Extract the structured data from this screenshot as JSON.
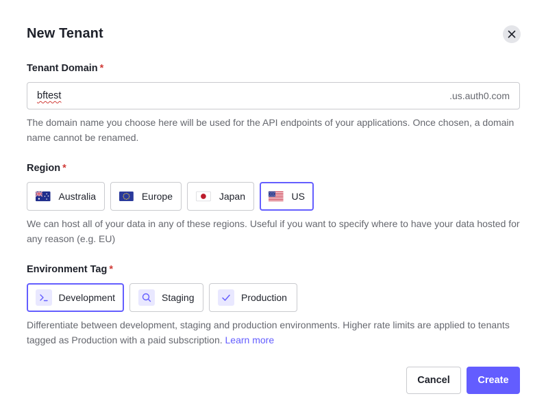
{
  "dialog": {
    "title": "New Tenant"
  },
  "tenant_domain": {
    "label": "Tenant Domain",
    "required_mark": "*",
    "value": "bftest",
    "suffix": ".us.auth0.com",
    "help": "The domain name you choose here will be used for the API endpoints of your applications. Once chosen, a domain name cannot be renamed."
  },
  "region": {
    "label": "Region",
    "required_mark": "*",
    "options": [
      {
        "label": "Australia",
        "icon": "australia-flag-icon"
      },
      {
        "label": "Europe",
        "icon": "eu-flag-icon"
      },
      {
        "label": "Japan",
        "icon": "japan-flag-icon"
      },
      {
        "label": "US",
        "icon": "us-flag-icon",
        "selected": true
      }
    ],
    "help": "We can host all of your data in any of these regions. Useful if you want to specify where to have your data hosted for any reason (e.g. EU)"
  },
  "environment": {
    "label": "Environment Tag",
    "required_mark": "*",
    "options": [
      {
        "label": "Development",
        "icon": "terminal-icon",
        "selected": true
      },
      {
        "label": "Staging",
        "icon": "search-icon"
      },
      {
        "label": "Production",
        "icon": "check-icon"
      }
    ],
    "help": "Differentiate between development, staging and production environments. Higher rate limits are applied to tenants tagged as Production with a paid subscription.",
    "learn_more": "Learn more"
  },
  "actions": {
    "cancel": "Cancel",
    "create": "Create"
  },
  "colors": {
    "accent": "#635dff",
    "required": "#d03c38",
    "muted_text": "#65676e",
    "border": "#c9cace"
  }
}
